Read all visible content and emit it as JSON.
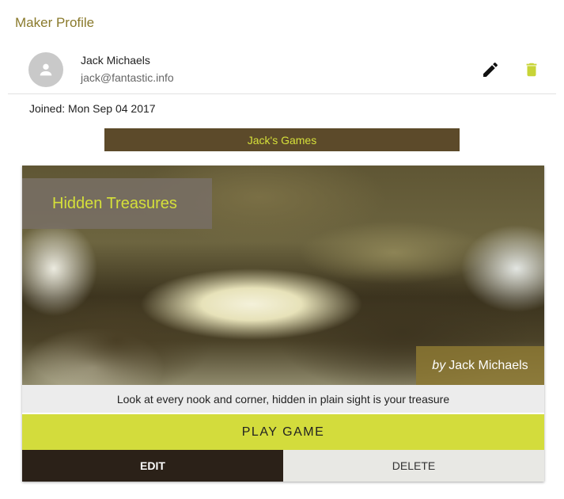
{
  "page": {
    "title": "Maker Profile"
  },
  "profile": {
    "name": "Jack Michaels",
    "email": "jack@fantastic.info",
    "joined": "Joined: Mon Sep 04 2017",
    "avatar_icon": "person-icon",
    "edit_icon": "pencil-icon",
    "delete_icon": "trash-icon"
  },
  "games_section": {
    "header": "Jack's Games"
  },
  "game": {
    "title": "Hidden Treasures",
    "byline_prefix": "by",
    "author": "Jack Michaels",
    "description": "Look at every nook and corner, hidden in plain sight is your treasure",
    "play_label": "PLAY GAME",
    "edit_label": "EDIT",
    "delete_label": "DELETE"
  },
  "colors": {
    "title_olive": "#8a7a2c",
    "accent_lime": "#d3dc3c",
    "header_brown": "#5c4a2a",
    "edit_dark": "#2b2118",
    "delete_icon_lime": "#c8d437"
  }
}
